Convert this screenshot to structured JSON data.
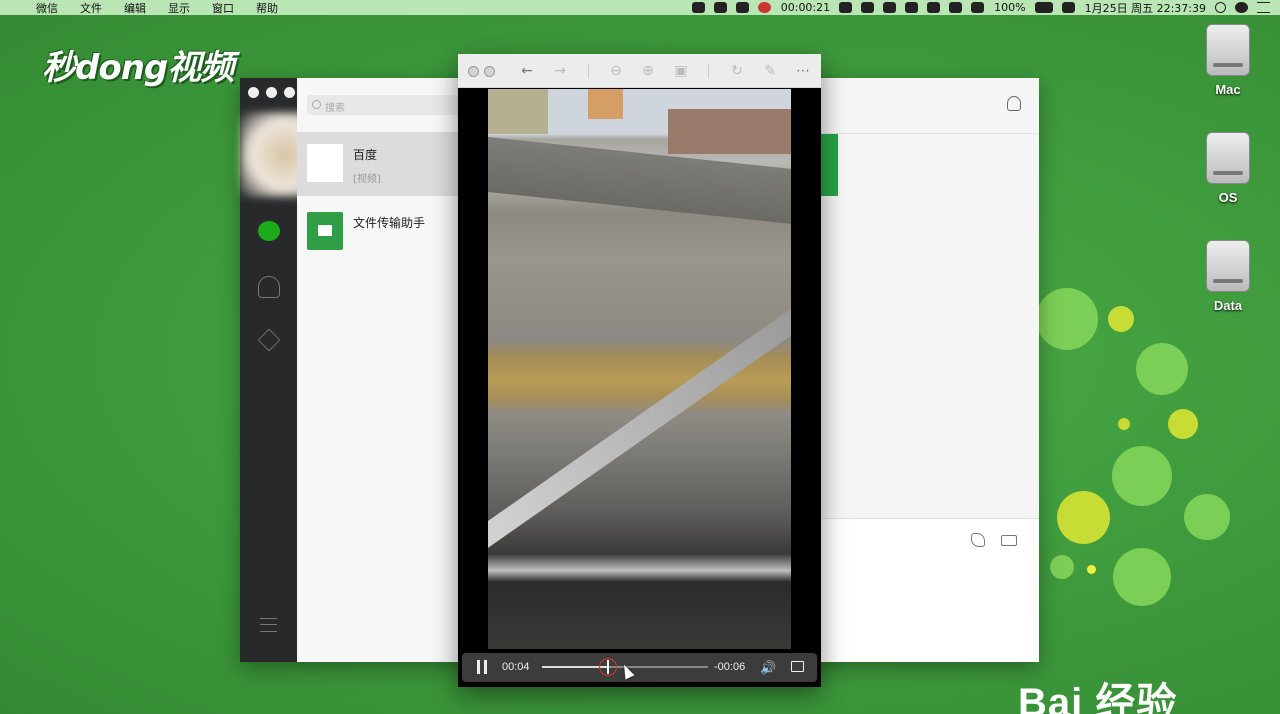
{
  "menubar": {
    "apple": "",
    "menus": [
      "微信",
      "文件",
      "编辑",
      "显示",
      "窗口",
      "帮助"
    ],
    "record_time": "00:00:21",
    "battery": "100%",
    "datetime": "1月25日 周五 22:37:39"
  },
  "watermark": {
    "logo_text": "秒dong视频",
    "baidu_text": "Bai 经验"
  },
  "desktop": {
    "drives": [
      {
        "label": "Mac"
      },
      {
        "label": "OS"
      },
      {
        "label": "Data"
      }
    ]
  },
  "wechat": {
    "search_placeholder": "搜索",
    "chats": [
      {
        "name": "百度",
        "preview": "[视频]"
      },
      {
        "name": "文件传输助手",
        "preview": ""
      }
    ]
  },
  "player": {
    "elapsed": "00:04",
    "remaining": "-00:06",
    "progress": 0.4,
    "volume_icon": "🔊"
  },
  "colors": {
    "desktop_green": "#3f9a3f",
    "wechat_green": "#1aad19",
    "menubar": "#b9e6b4"
  }
}
